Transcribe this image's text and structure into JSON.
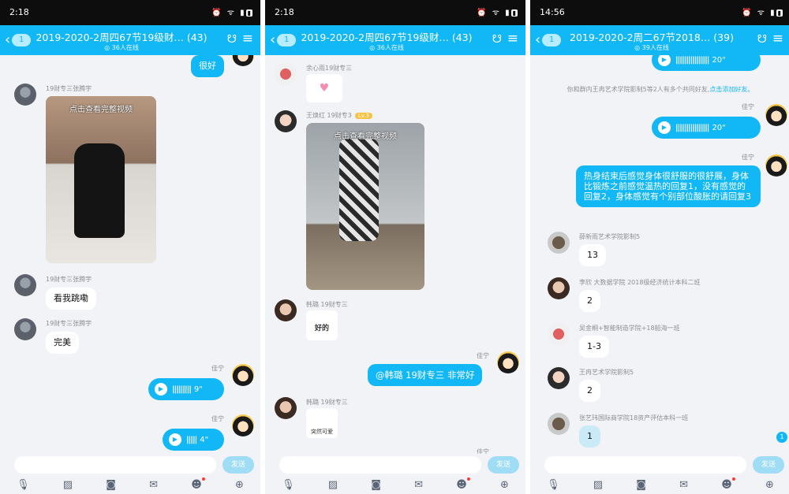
{
  "panels": [
    {
      "time": "2:18",
      "title": "2019-2020-2周四67节19级财… (43)",
      "subtitle": "◎ 36人在线",
      "back_count": "1",
      "messages": {
        "m0": "很好",
        "n1": "19财专三张腾宇",
        "video1_caption": "点击查看完整视频",
        "n2": "19财专三张腾宇",
        "m2": "看我跳嘞",
        "n3": "19财专三张腾宇",
        "m3": "完美",
        "n4": "佳宁",
        "v4": "9\"",
        "n5": "佳宁",
        "v5": "4\""
      },
      "send": "发送"
    },
    {
      "time": "2:18",
      "title": "2019-2020-2周四67节19级财… (43)",
      "subtitle": "◎ 36人在线",
      "back_count": "1",
      "messages": {
        "n1": "余心雨19财专三",
        "n2": "王焕红 19财专3",
        "badge2": "Lv.3",
        "video2_caption": "点击查看完整视频",
        "n3": "韩璐 19财专三",
        "sticker3": "好的",
        "n4": "佳宁",
        "m4": "@韩璐 19财专三 非常好",
        "n5": "韩璐 19财专三",
        "sticker5": "突然可爱",
        "n6": "佳宁"
      },
      "send": "发送"
    },
    {
      "time": "14:56",
      "title": "2019-2020-2周二67节2018… (39)",
      "subtitle": "◎ 39人在线",
      "back_count": "1",
      "messages": {
        "v0": "20\"",
        "sys": "你和群内王冉艺术学院影制5等2人有多个共同好友,",
        "sys_link": "点击添加好友。",
        "n1": "佳宁",
        "v1": "20\"",
        "n2": "佳宁",
        "m2": "热身结束后感觉身体很舒服的很舒展，身体比锻炼之前感觉温热的回复1，没有感觉的回复2，身体感觉有个别部位酸胀的请回复3",
        "n3": "薛新雨艺术学院影制5",
        "m3": "13",
        "n4": "李欣 大数据学院 2018级经济统计本科二班",
        "m4": "2",
        "n5": "吴金桐+智能制造学院+18船海一班",
        "m5": "1-3",
        "n6": "王冉艺术学院影制5",
        "m6": "2",
        "n7": "张艺玮国际商学院18资产评估本科一班",
        "m7": "1",
        "unread": "1"
      },
      "send": "发送"
    }
  ],
  "colors": {
    "accent": "#12b7f5",
    "statusbar": "#0d0d0d",
    "background": "#f2f3f7"
  },
  "toolbar_icons": [
    "microphone-icon",
    "image-icon",
    "camera-icon",
    "red-packet-icon",
    "emoji-icon",
    "plus-icon"
  ]
}
